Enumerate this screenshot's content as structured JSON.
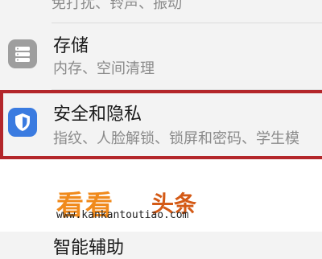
{
  "settings": {
    "prev_item": {
      "subtitle": "免打扰、铃声、振动"
    },
    "storage": {
      "title": "存储",
      "subtitle": "内存、空间清理",
      "icon": "storage-icon"
    },
    "security": {
      "title": "安全和隐私",
      "subtitle": "指纹、人脸解锁、锁屏和密码、学生模",
      "icon": "shield-icon",
      "highlight_color": "#b3262a"
    },
    "next_item": {
      "title": "智能辅助"
    }
  },
  "watermark": {
    "logo_a": "看看",
    "logo_b": "头条",
    "url": "www.kankantoutiao.com"
  },
  "colors": {
    "storage_icon_bg": "#9e9e9e",
    "shield_icon_bg": "#3a7be0",
    "accent": "#f08a1c"
  }
}
